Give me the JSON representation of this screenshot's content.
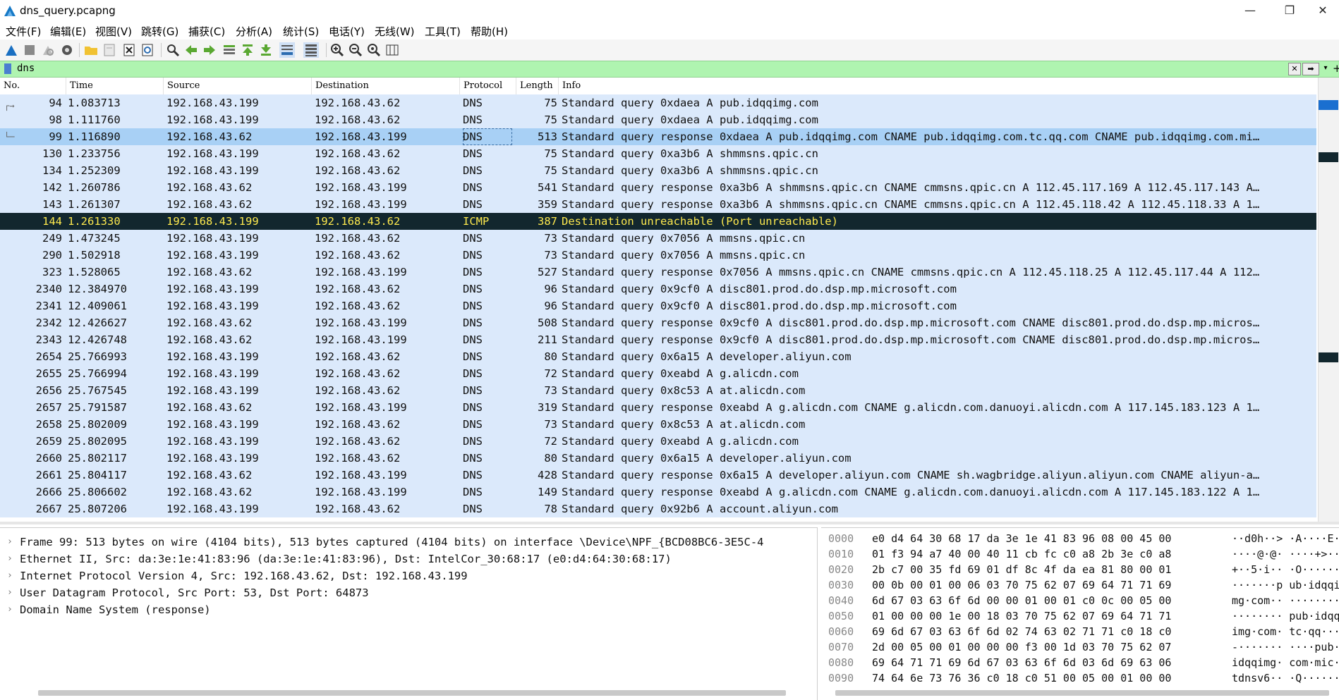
{
  "window": {
    "title": "dns_query.pcapng",
    "minimize": "—",
    "maximize": "❐",
    "close": "✕"
  },
  "menu": [
    "文件(F)",
    "编辑(E)",
    "视图(V)",
    "跳转(G)",
    "捕获(C)",
    "分析(A)",
    "统计(S)",
    "电话(Y)",
    "无线(W)",
    "工具(T)",
    "帮助(H)"
  ],
  "toolbar_icons": [
    "shark-fin-start-icon",
    "stop-capture-icon",
    "restart-capture-icon",
    "capture-options-icon",
    "open-file-icon",
    "save-file-icon",
    "close-file-icon",
    "reload-file-icon",
    "find-packet-icon",
    "go-back-icon",
    "go-forward-icon",
    "go-to-packet-icon",
    "go-first-icon",
    "go-last-icon",
    "auto-scroll-icon",
    "colorize-icon",
    "zoom-in-icon",
    "zoom-out-icon",
    "zoom-normal-icon",
    "resize-columns-icon"
  ],
  "filter": {
    "value": "dns",
    "clear": "✕",
    "apply": "➡",
    "dropdown": "▾",
    "add": "+"
  },
  "columns": {
    "no": "No.",
    "time": "Time",
    "source": "Source",
    "destination": "Destination",
    "protocol": "Protocol",
    "length": "Length",
    "info": "Info"
  },
  "packets": [
    {
      "no": "94",
      "time": "1.083713",
      "src": "192.168.43.199",
      "dst": "192.168.43.62",
      "proto": "DNS",
      "len": "75",
      "info": "Standard query 0xdaea A pub.idqqimg.com"
    },
    {
      "no": "98",
      "time": "1.111760",
      "src": "192.168.43.199",
      "dst": "192.168.43.62",
      "proto": "DNS",
      "len": "75",
      "info": "Standard query 0xdaea A pub.idqqimg.com"
    },
    {
      "no": "99",
      "time": "1.116890",
      "src": "192.168.43.62",
      "dst": "192.168.43.199",
      "proto": "DNS",
      "len": "513",
      "info": "Standard query response 0xdaea A pub.idqqimg.com CNAME pub.idqqimg.com.tc.qq.com CNAME pub.idqqimg.com.mi…"
    },
    {
      "no": "130",
      "time": "1.233756",
      "src": "192.168.43.199",
      "dst": "192.168.43.62",
      "proto": "DNS",
      "len": "75",
      "info": "Standard query 0xa3b6 A shmmsns.qpic.cn"
    },
    {
      "no": "134",
      "time": "1.252309",
      "src": "192.168.43.199",
      "dst": "192.168.43.62",
      "proto": "DNS",
      "len": "75",
      "info": "Standard query 0xa3b6 A shmmsns.qpic.cn"
    },
    {
      "no": "142",
      "time": "1.260786",
      "src": "192.168.43.62",
      "dst": "192.168.43.199",
      "proto": "DNS",
      "len": "541",
      "info": "Standard query response 0xa3b6 A shmmsns.qpic.cn CNAME cmmsns.qpic.cn A 112.45.117.169 A 112.45.117.143 A…"
    },
    {
      "no": "143",
      "time": "1.261307",
      "src": "192.168.43.62",
      "dst": "192.168.43.199",
      "proto": "DNS",
      "len": "359",
      "info": "Standard query response 0xa3b6 A shmmsns.qpic.cn CNAME cmmsns.qpic.cn A 112.45.118.42 A 112.45.118.33 A 1…"
    },
    {
      "no": "144",
      "time": "1.261330",
      "src": "192.168.43.199",
      "dst": "192.168.43.62",
      "proto": "ICMP",
      "len": "387",
      "info": "Destination unreachable (Port unreachable)"
    },
    {
      "no": "249",
      "time": "1.473245",
      "src": "192.168.43.199",
      "dst": "192.168.43.62",
      "proto": "DNS",
      "len": "73",
      "info": "Standard query 0x7056 A mmsns.qpic.cn"
    },
    {
      "no": "290",
      "time": "1.502918",
      "src": "192.168.43.199",
      "dst": "192.168.43.62",
      "proto": "DNS",
      "len": "73",
      "info": "Standard query 0x7056 A mmsns.qpic.cn"
    },
    {
      "no": "323",
      "time": "1.528065",
      "src": "192.168.43.62",
      "dst": "192.168.43.199",
      "proto": "DNS",
      "len": "527",
      "info": "Standard query response 0x7056 A mmsns.qpic.cn CNAME cmmsns.qpic.cn A 112.45.118.25 A 112.45.117.44 A 112…"
    },
    {
      "no": "2340",
      "time": "12.384970",
      "src": "192.168.43.199",
      "dst": "192.168.43.62",
      "proto": "DNS",
      "len": "96",
      "info": "Standard query 0x9cf0 A disc801.prod.do.dsp.mp.microsoft.com"
    },
    {
      "no": "2341",
      "time": "12.409061",
      "src": "192.168.43.199",
      "dst": "192.168.43.62",
      "proto": "DNS",
      "len": "96",
      "info": "Standard query 0x9cf0 A disc801.prod.do.dsp.mp.microsoft.com"
    },
    {
      "no": "2342",
      "time": "12.426627",
      "src": "192.168.43.62",
      "dst": "192.168.43.199",
      "proto": "DNS",
      "len": "508",
      "info": "Standard query response 0x9cf0 A disc801.prod.do.dsp.mp.microsoft.com CNAME disc801.prod.do.dsp.mp.micros…"
    },
    {
      "no": "2343",
      "time": "12.426748",
      "src": "192.168.43.62",
      "dst": "192.168.43.199",
      "proto": "DNS",
      "len": "211",
      "info": "Standard query response 0x9cf0 A disc801.prod.do.dsp.mp.microsoft.com CNAME disc801.prod.do.dsp.mp.micros…"
    },
    {
      "no": "2654",
      "time": "25.766993",
      "src": "192.168.43.199",
      "dst": "192.168.43.62",
      "proto": "DNS",
      "len": "80",
      "info": "Standard query 0x6a15 A developer.aliyun.com"
    },
    {
      "no": "2655",
      "time": "25.766994",
      "src": "192.168.43.199",
      "dst": "192.168.43.62",
      "proto": "DNS",
      "len": "72",
      "info": "Standard query 0xeabd A g.alicdn.com"
    },
    {
      "no": "2656",
      "time": "25.767545",
      "src": "192.168.43.199",
      "dst": "192.168.43.62",
      "proto": "DNS",
      "len": "73",
      "info": "Standard query 0x8c53 A at.alicdn.com"
    },
    {
      "no": "2657",
      "time": "25.791587",
      "src": "192.168.43.62",
      "dst": "192.168.43.199",
      "proto": "DNS",
      "len": "319",
      "info": "Standard query response 0xeabd A g.alicdn.com CNAME g.alicdn.com.danuoyi.alicdn.com A 117.145.183.123 A 1…"
    },
    {
      "no": "2658",
      "time": "25.802009",
      "src": "192.168.43.199",
      "dst": "192.168.43.62",
      "proto": "DNS",
      "len": "73",
      "info": "Standard query 0x8c53 A at.alicdn.com"
    },
    {
      "no": "2659",
      "time": "25.802095",
      "src": "192.168.43.199",
      "dst": "192.168.43.62",
      "proto": "DNS",
      "len": "72",
      "info": "Standard query 0xeabd A g.alicdn.com"
    },
    {
      "no": "2660",
      "time": "25.802117",
      "src": "192.168.43.199",
      "dst": "192.168.43.62",
      "proto": "DNS",
      "len": "80",
      "info": "Standard query 0x6a15 A developer.aliyun.com"
    },
    {
      "no": "2661",
      "time": "25.804117",
      "src": "192.168.43.62",
      "dst": "192.168.43.199",
      "proto": "DNS",
      "len": "428",
      "info": "Standard query response 0x6a15 A developer.aliyun.com CNAME sh.wagbridge.aliyun.aliyun.com CNAME aliyun-a…"
    },
    {
      "no": "2666",
      "time": "25.806602",
      "src": "192.168.43.62",
      "dst": "192.168.43.199",
      "proto": "DNS",
      "len": "149",
      "info": "Standard query response 0xeabd A g.alicdn.com CNAME g.alicdn.com.danuoyi.alicdn.com A 117.145.183.122 A 1…"
    },
    {
      "no": "2667",
      "time": "25.807206",
      "src": "192.168.43.199",
      "dst": "192.168.43.62",
      "proto": "DNS",
      "len": "78",
      "info": "Standard query 0x92b6 A account.aliyun.com"
    }
  ],
  "selected_packet_no": "99",
  "details": [
    "Frame 99: 513 bytes on wire (4104 bits), 513 bytes captured (4104 bits) on interface \\Device\\NPF_{BCD08BC6-3E5C-4",
    "Ethernet II, Src: da:3e:1e:41:83:96 (da:3e:1e:41:83:96), Dst: IntelCor_30:68:17 (e0:d4:64:30:68:17)",
    "Internet Protocol Version 4, Src: 192.168.43.62, Dst: 192.168.43.199",
    "User Datagram Protocol, Src Port: 53, Dst Port: 64873",
    "Domain Name System (response)"
  ],
  "hex": [
    {
      "off": "0000",
      "bytes": "e0 d4 64 30 68 17 da 3e  1e 41 83 96 08 00 45 00",
      "ascii": "··d0h··> ·A····E·"
    },
    {
      "off": "0010",
      "bytes": "01 f3 94 a7 40 00 40 11  cb fc c0 a8 2b 3e c0 a8",
      "ascii": "····@·@· ····+>··"
    },
    {
      "off": "0020",
      "bytes": "2b c7 00 35 fd 69 01 df  8c 4f da ea 81 80 00 01",
      "ascii": "+··5·i·· ·O······"
    },
    {
      "off": "0030",
      "bytes": "00 0b 00 01 00 06 03 70  75 62 07 69 64 71 71 69",
      "ascii": "·······p ub·idqqi"
    },
    {
      "off": "0040",
      "bytes": "6d 67 03 63 6f 6d 00 00  01 00 01 c0 0c 00 05 00",
      "ascii": "mg·com·· ········"
    },
    {
      "off": "0050",
      "bytes": "01 00 00 00 1e 00 18 03  70 75 62 07 69 64 71 71",
      "ascii": "········ pub·idqq"
    },
    {
      "off": "0060",
      "bytes": "69 6d 67 03 63 6f 6d 02  74 63 02 71 71 c0 18 c0",
      "ascii": "img·com· tc·qq···"
    },
    {
      "off": "0070",
      "bytes": "2d 00 05 00 01 00 00 00  f3 00 1d 03 70 75 62 07",
      "ascii": "-······· ····pub·"
    },
    {
      "off": "0080",
      "bytes": "69 64 71 71 69 6d 67 03  63 6f 6d 03 6d 69 63 06",
      "ascii": "idqqimg· com·mic·"
    },
    {
      "off": "0090",
      "bytes": "74 64 6e 73 76 36 c0 18  c0 51 00 05 00 01 00 00",
      "ascii": "tdnsv6·· ·Q······"
    }
  ],
  "colors": {
    "dns_row": "#dbe9fb",
    "selected_row": "#a8d0f5",
    "icmp_row_bg": "#12272e",
    "icmp_row_fg": "#fce84e",
    "filter_bg": "#aff4b0"
  }
}
